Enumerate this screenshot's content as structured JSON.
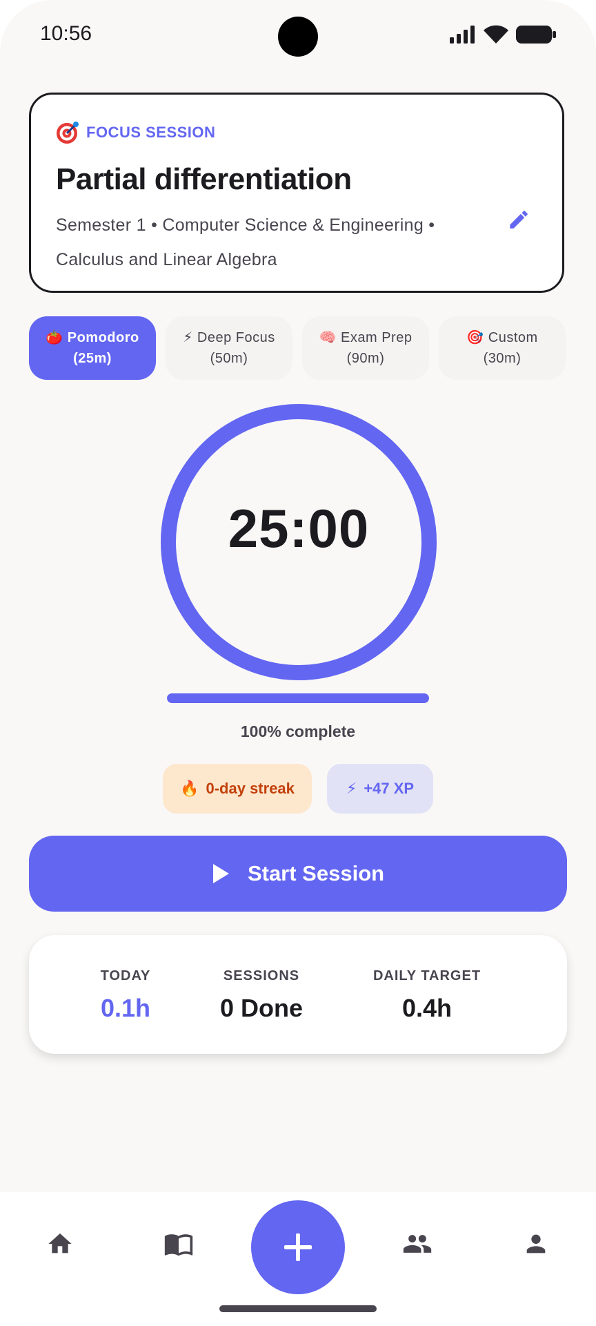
{
  "status_bar": {
    "time": "10:56"
  },
  "focus_card": {
    "label": "FOCUS SESSION",
    "title": "Partial differentiation",
    "subtitle": "Semester 1 • Computer Science & Engineering • Calculus and Linear Algebra"
  },
  "presets": [
    {
      "emoji": "🍅",
      "name": "Pomodoro",
      "duration": "(25m)",
      "active": true
    },
    {
      "emoji": "⚡",
      "name": "Deep Focus",
      "duration": "(50m)",
      "active": false
    },
    {
      "emoji": "🧠",
      "name": "Exam Prep",
      "duration": "(90m)",
      "active": false
    },
    {
      "emoji": "🎯",
      "name": "Custom",
      "duration": "(30m)",
      "active": false
    }
  ],
  "timer": {
    "display": "25:00",
    "progress_percent": 100,
    "progress_label": "100% complete"
  },
  "chips": {
    "streak_icon": "🔥",
    "streak": "0-day streak",
    "xp_icon": "⚡",
    "xp": "+47 XP"
  },
  "start_button": {
    "label": "Start Session"
  },
  "stats": [
    {
      "label": "TODAY",
      "value": "0.1h",
      "accent": true
    },
    {
      "label": "SESSIONS",
      "value": "0 Done",
      "accent": false
    },
    {
      "label": "DAILY TARGET",
      "value": "0.4h",
      "accent": false
    }
  ],
  "colors": {
    "primary": "#6366f1",
    "streak_bg": "#fde7cd",
    "streak_text": "#c2410c",
    "xp_bg": "#e2e2f6"
  },
  "nav": {
    "icons": [
      "home-icon",
      "book-icon",
      "add-icon",
      "group-icon",
      "person-icon"
    ]
  }
}
